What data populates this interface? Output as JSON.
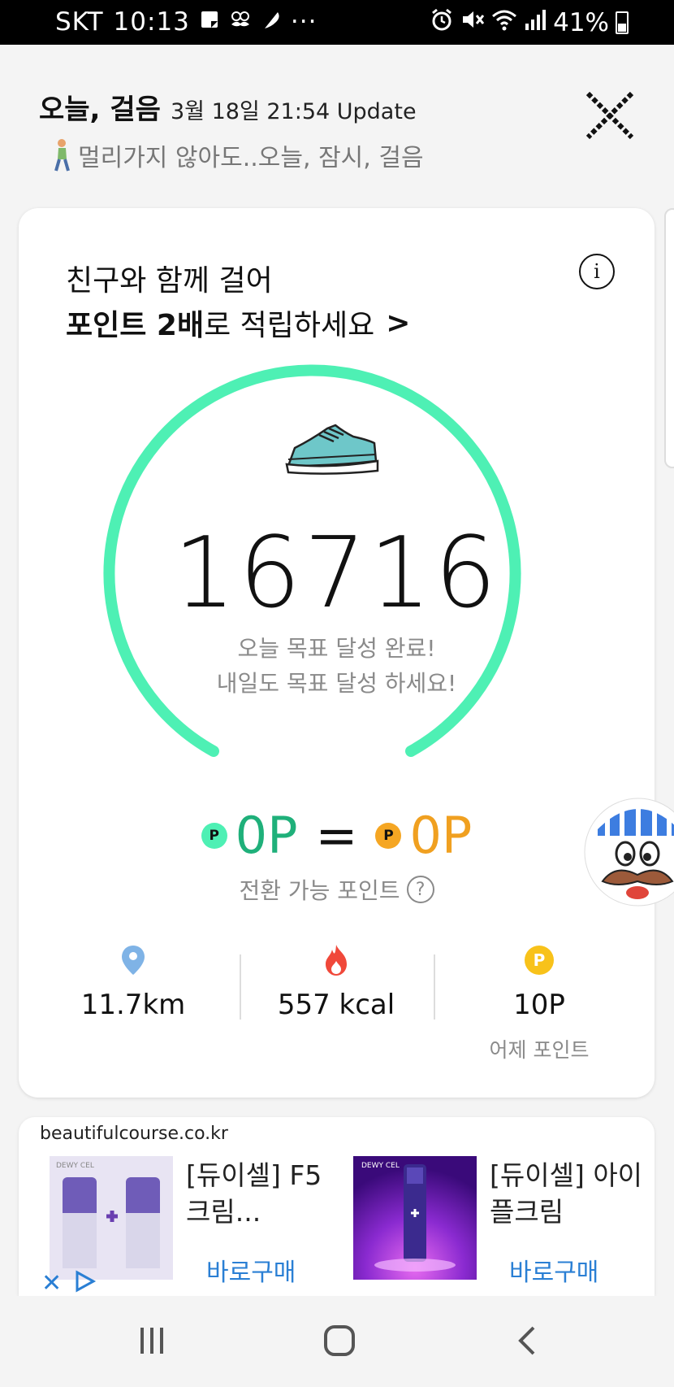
{
  "status_bar": {
    "carrier": "SKT",
    "time": "10:13",
    "more": "···",
    "battery": "41%",
    "battery_level": 0.41
  },
  "header": {
    "title": "오늘, 걸음",
    "updated": "3월 18일 21:54 Update",
    "subtitle": "멀리가지 않아도..오늘, 잠시, 걸음"
  },
  "promo": {
    "line1": "친구와 함께 걸어",
    "line2_bold": "포인트 2배",
    "line2_rest": "로 적립하세요",
    "chevron": ">"
  },
  "gauge": {
    "steps": "16716",
    "goal_progress": 1.0,
    "ring_color": "#4ef0b4",
    "message_line1": "오늘 목표 달성 완료!",
    "message_line2": "내일도 목표 달성 하세요!"
  },
  "points": {
    "coin_letter": "P",
    "left_value": "0P",
    "equals": "=",
    "right_value": "0P",
    "convertible_label": "전환 가능 포인트",
    "help": "?"
  },
  "stats": [
    {
      "icon": "location-pin-icon",
      "value": "11.7km",
      "label": ""
    },
    {
      "icon": "fire-icon",
      "value": "557 kcal",
      "label": ""
    },
    {
      "icon": "point-coin-icon",
      "value": "10P",
      "label": "어제 포인트"
    }
  ],
  "ad": {
    "domain": "beautifulcourse.co.kr",
    "items": [
      {
        "title": "[듀이셀] F5 크림...",
        "buy": "바로구매",
        "brand": "DEWY CEL"
      },
      {
        "title": "[듀이셀] 아이플크림",
        "buy": "바로구매",
        "brand": "DEWY CEL"
      }
    ]
  },
  "colors": {
    "accent_green": "#4ef0b4",
    "point_green_text": "#1fb07a",
    "point_orange": "#f0a020",
    "link_blue": "#2a7fd4"
  }
}
